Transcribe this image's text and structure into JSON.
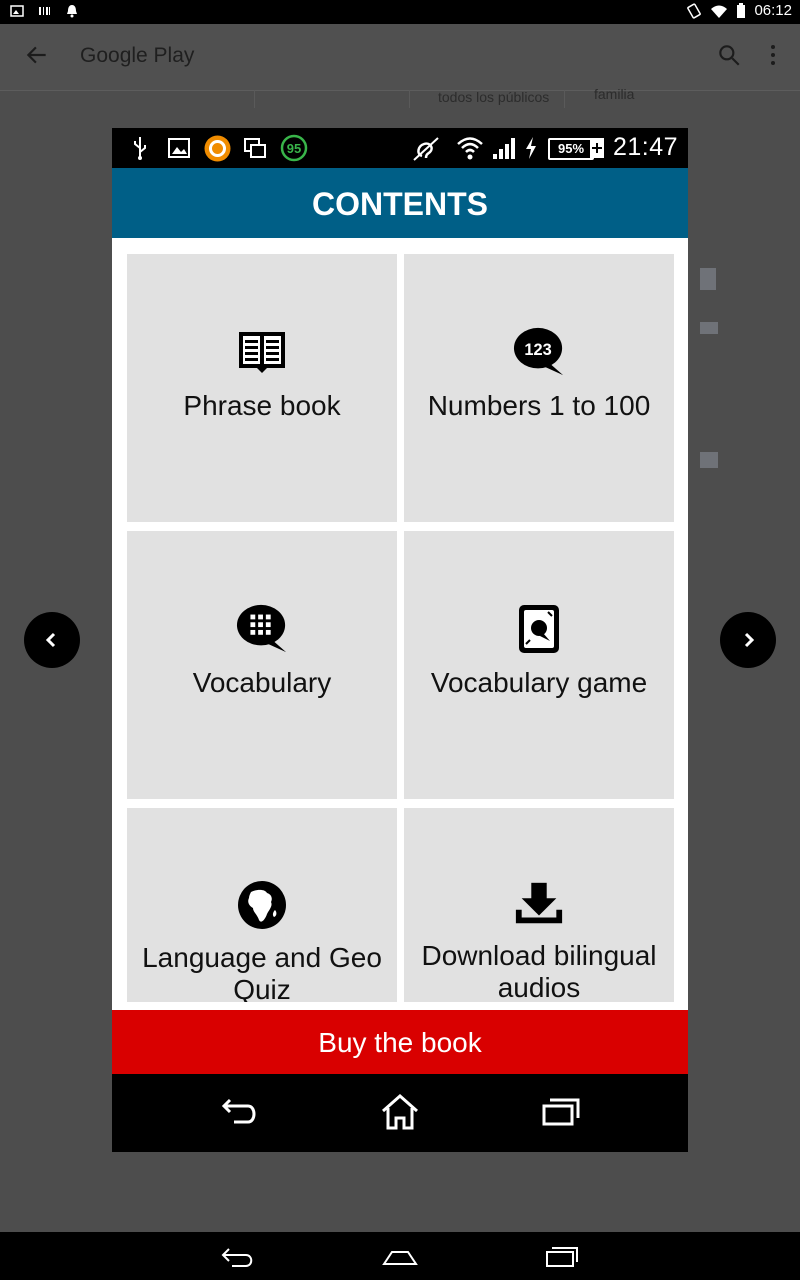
{
  "system": {
    "time": "06:12"
  },
  "store": {
    "title": "Google Play",
    "age_rating": "todos los públicos",
    "family_label": "familia"
  },
  "phone": {
    "status": {
      "time": "21:47",
      "battery": "95%",
      "badge": "95"
    },
    "header": "CONTENTS",
    "tiles": [
      {
        "label": "Phrase book",
        "icon": "phrase-book-icon"
      },
      {
        "label": "Numbers 1 to 100",
        "icon": "numbers-bubble-icon",
        "icon_text": "123"
      },
      {
        "label": "Vocabulary",
        "icon": "vocabulary-bubble-icon"
      },
      {
        "label": "Vocabulary game",
        "icon": "playing-card-icon"
      },
      {
        "label": "Language and Geo Quiz",
        "icon": "globe-icon"
      },
      {
        "label": "Download bilingual audios",
        "icon": "download-icon"
      }
    ],
    "buy_button": "Buy the book"
  },
  "colors": {
    "header": "#005f87",
    "buy": "#d90000",
    "tile": "#e1e1e1",
    "overlay": "#4d4d4d"
  }
}
